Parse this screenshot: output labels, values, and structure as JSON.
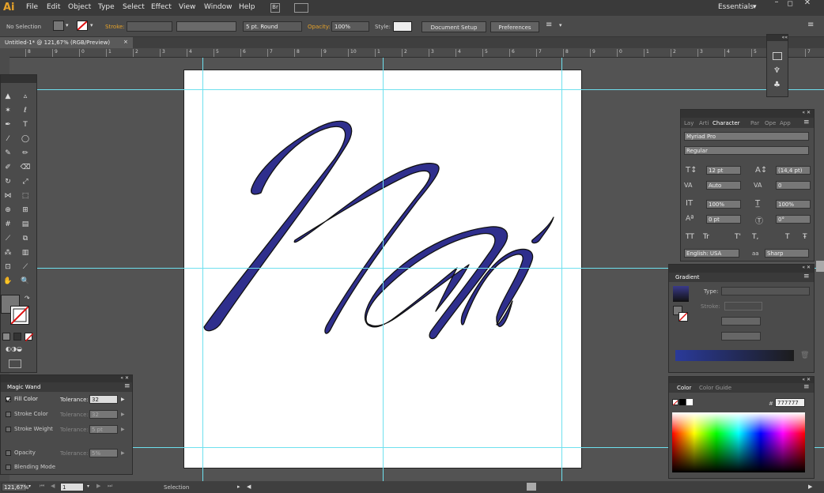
{
  "app": {
    "logo": "Ai",
    "menus": [
      "File",
      "Edit",
      "Object",
      "Type",
      "Select",
      "Effect",
      "View",
      "Window",
      "Help"
    ],
    "workspace": "Essentials"
  },
  "control": {
    "selection": "No Selection",
    "stroke_label": "Stroke:",
    "brush": "5 pt. Round",
    "opacity_label": "Opacity:",
    "opacity_value": "100%",
    "style_label": "Style:",
    "doc_setup": "Document Setup",
    "preferences": "Preferences"
  },
  "document": {
    "tab_title": "Untitled-1* @ 121,67% (RGB/Preview)"
  },
  "ruler": {
    "ticks": [
      "8",
      "9",
      "0",
      "1",
      "2",
      "3",
      "4",
      "5",
      "6",
      "7",
      "8",
      "9",
      "10",
      "1",
      "2",
      "3",
      "4",
      "5",
      "6",
      "7",
      "8",
      "9",
      "0",
      "1",
      "2",
      "3",
      "4",
      "5",
      "6",
      "7"
    ]
  },
  "artwork": {
    "text": "Nai",
    "fill": "#2f2f8d"
  },
  "character": {
    "tabs": [
      "Lay",
      "Arti",
      "Character",
      "Par",
      "Ope",
      "App"
    ],
    "font": "Myriad Pro",
    "style": "Regular",
    "size": "12 pt",
    "leading": "(14,4 pt)",
    "kerning": "Auto",
    "tracking": "0",
    "vscale": "100%",
    "hscale": "100%",
    "baseline": "0 pt",
    "rotation": "0°",
    "language": "English: USA",
    "aa_label": "aa",
    "antialias": "Sharp",
    "glyphs": [
      "TT",
      "Tr",
      "T'",
      "T,",
      "T",
      "Ŧ"
    ]
  },
  "gradient": {
    "title": "Gradient",
    "type_label": "Type:",
    "stroke_label": "Stroke:"
  },
  "color": {
    "tabs": [
      "Color",
      "Color Guide"
    ],
    "hash": "#",
    "hex": "777777"
  },
  "magicwand": {
    "title": "Magic Wand",
    "rows": [
      {
        "label": "Fill Color",
        "tol_label": "Tolerance:",
        "value": "32",
        "checked": true
      },
      {
        "label": "Stroke Color",
        "tol_label": "Tolerance:",
        "value": "32",
        "checked": false
      },
      {
        "label": "Stroke Weight",
        "tol_label": "Tolerance:",
        "value": "5 pt",
        "checked": false
      },
      {
        "label": "Opacity",
        "tol_label": "Tolerance:",
        "value": "5%",
        "checked": false
      },
      {
        "label": "Blending Mode",
        "tol_label": "",
        "value": "",
        "checked": false
      }
    ]
  },
  "status": {
    "zoom": "121,67%",
    "page": "1",
    "tool": "Selection"
  },
  "colors": {
    "guide": "#6ee0ee",
    "accent": "#e6a22a"
  }
}
